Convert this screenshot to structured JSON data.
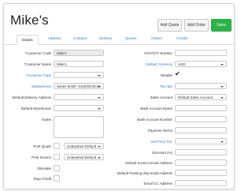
{
  "header": {
    "title": "Mike's",
    "add_quote": "Add Quote",
    "add_order": "Add Order",
    "save": "Save"
  },
  "tabs": [
    {
      "label": "Details"
    },
    {
      "label": "Address"
    },
    {
      "label": "Contacts"
    },
    {
      "label": "Delivery"
    },
    {
      "label": "Quotes"
    },
    {
      "label": "Orders"
    },
    {
      "label": "Credits"
    }
  ],
  "left": {
    "customer_code": {
      "label": "*Customer Code",
      "value": "Mike's"
    },
    "customer_name": {
      "label": "*Customer Name",
      "value": "Mike's"
    },
    "customer_type": {
      "label": "*Customer Type",
      "value": ""
    },
    "salesperson": {
      "label": "Salesperson",
      "value": "Sarah Smith: SS@WCECO"
    },
    "default_delivery_address": {
      "label": "Default Delivery Address",
      "value": ""
    },
    "default_warehouse": {
      "label": "Default Warehouse",
      "value": ""
    },
    "notes": {
      "label": "Notes"
    },
    "print_quote": {
      "label": "Print Quote",
      "value": "Unleashed Default"
    },
    "print_invoice": {
      "label": "Print Invoice",
      "value": "Unleashed Default"
    },
    "obsolete": {
      "label": "Obsolete"
    },
    "stop_credit": {
      "label": "Stop Credit"
    }
  },
  "right": {
    "gst_vat_number": {
      "label": "GST/VAT Number",
      "value": ""
    },
    "default_currency": {
      "label": "Default Currency",
      "value": "USD"
    },
    "taxable": {
      "label": "Taxable",
      "checked": true
    },
    "tax_rate": {
      "label": "Tax rate",
      "value": ""
    },
    "sales_account": {
      "label": "Sales Account",
      "value": "Default Sales Account"
    },
    "bank_account_name": {
      "label": "Bank Account Name",
      "value": ""
    },
    "bank_account_number": {
      "label": "Bank Account Number",
      "value": ""
    },
    "payment_terms": {
      "label": "Payment Terms",
      "value": ""
    },
    "sell_price_tier": {
      "label": "Sell Price Tier",
      "value": ""
    },
    "discount": {
      "label": "Discount (%)",
      "value": ""
    },
    "default_invoice_email": {
      "label": "Default Invoice Email Address",
      "value": ""
    },
    "default_packing_slip_email": {
      "label": "Default Packing Slip Email Address",
      "value": ""
    },
    "email_cc": {
      "label": "Email CC Address",
      "value": ""
    }
  },
  "colors": {
    "accent": "#3a78c3",
    "save": "#2bb34a"
  }
}
